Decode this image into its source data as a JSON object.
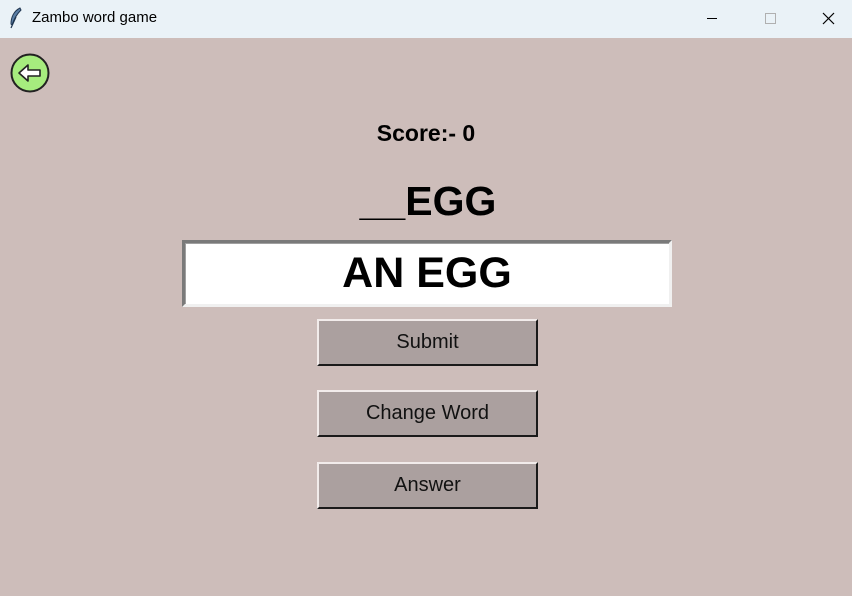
{
  "window": {
    "title": "Zambo word game",
    "background": "#cdbdba"
  },
  "icons": {
    "app": "feather-icon",
    "minimize": "minimize-icon",
    "maximize": "maximize-icon",
    "close": "close-icon",
    "back": "back-arrow-icon"
  },
  "game": {
    "score_text": "Score:- 0",
    "word": "__EGG",
    "answer_value": "AN EGG"
  },
  "buttons": {
    "submit": "Submit",
    "change_word": "Change Word",
    "answer": "Answer"
  },
  "colors": {
    "button_bg": "#aba09f",
    "back_button": "#a6ec7e",
    "titlebar": "#eaf2f7"
  }
}
